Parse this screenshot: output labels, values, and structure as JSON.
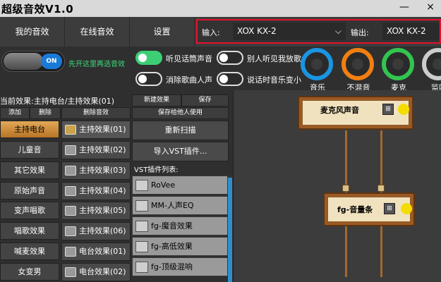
{
  "window": {
    "title": "超级音效V1.0",
    "minimize": "—",
    "close": "×"
  },
  "nav": {
    "tabs": [
      "我的音效",
      "在线音效",
      "设置"
    ]
  },
  "io": {
    "input_label": "输入:",
    "input_value": "XOX KX-2",
    "output_label": "输出:",
    "output_value": "XOX KX-2"
  },
  "master": {
    "toggle_label": "ON",
    "hint": "先开这里再选音效"
  },
  "options": [
    {
      "label": "听见话筒声音",
      "on": true
    },
    {
      "label": "别人听见我放歌",
      "on": false
    },
    {
      "label": "消除歌曲人声",
      "on": false
    },
    {
      "label": "说话时音乐变小",
      "on": false
    }
  ],
  "knobs": [
    {
      "label": "音乐",
      "color": "#1a95e0"
    },
    {
      "label": "不混音",
      "color": "#f07f12"
    },
    {
      "label": "麦克",
      "color": "#32c44f"
    },
    {
      "label": "监听",
      "color": "#cccccc"
    }
  ],
  "current_effect": "当前效果:主持电台/主持效果(01)",
  "buttons": {
    "add": "添加",
    "delete": "删除",
    "delete_effect": "删除音效",
    "new_effect": "新建效果",
    "save": "保存",
    "save_to_user": "保存给他人使用",
    "rescan": "重新扫描",
    "import_vst": "导入VST插件..."
  },
  "categories": [
    "主持电台",
    "儿童音",
    "其它效果",
    "原始声音",
    "变声唱歌",
    "唱歌效果",
    "喊麦效果",
    "女变男"
  ],
  "effects": [
    "主持效果(01)",
    "主持效果(02)",
    "主持效果(03)",
    "主持效果(04)",
    "主持效果(05)",
    "主持效果(06)",
    "电台效果(01)",
    "电台效果(02)"
  ],
  "vst": {
    "title": "VST插件列表:",
    "items": [
      "RoVee",
      "MM-人声EQ",
      "fg-魔音效果",
      "fg-高低效果",
      "fg-顶级混响"
    ]
  },
  "nodes": [
    {
      "label": "麦克风声音",
      "mix": "⊞"
    },
    {
      "label": "fg-音量条",
      "mix": "⊞"
    }
  ]
}
